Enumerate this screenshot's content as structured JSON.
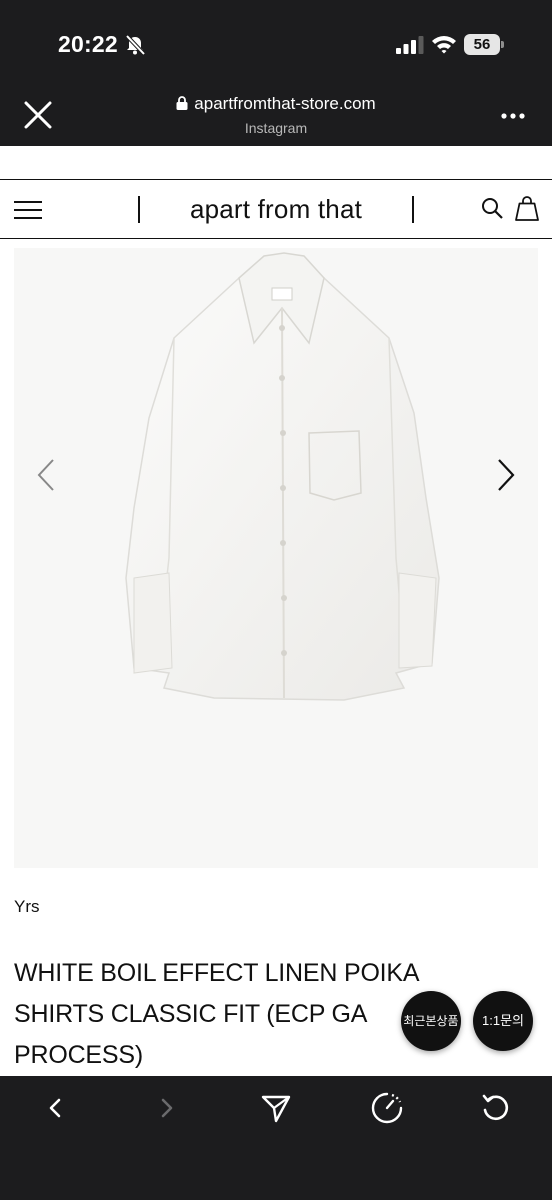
{
  "status_bar": {
    "time": "20:22",
    "battery": "56"
  },
  "browser": {
    "url": "apartfromthat-store.com",
    "source": "Instagram"
  },
  "site": {
    "brand": "apart from that"
  },
  "product": {
    "brand": "Yrs",
    "title_lines": [
      "WHITE BOIL EFFECT LINEN POIKA",
      "SHIRTS CLASSIC FIT (ECP GA",
      "PROCESS)"
    ]
  },
  "floating": {
    "recent": "최근본상품",
    "inquiry": "1:1문의"
  },
  "colors": {
    "chrome_dark": "#1c1c1e",
    "text": "#111111",
    "image_bg": "#f7f7f6"
  },
  "icons": [
    "bell-slash-icon",
    "signal-icon",
    "wifi-icon",
    "close-icon",
    "lock-icon",
    "more-icon",
    "hamburger-icon",
    "search-icon",
    "bag-icon",
    "chevron-left-icon",
    "chevron-right-icon",
    "back-icon",
    "forward-icon",
    "share-icon",
    "speed-icon",
    "reload-icon"
  ]
}
